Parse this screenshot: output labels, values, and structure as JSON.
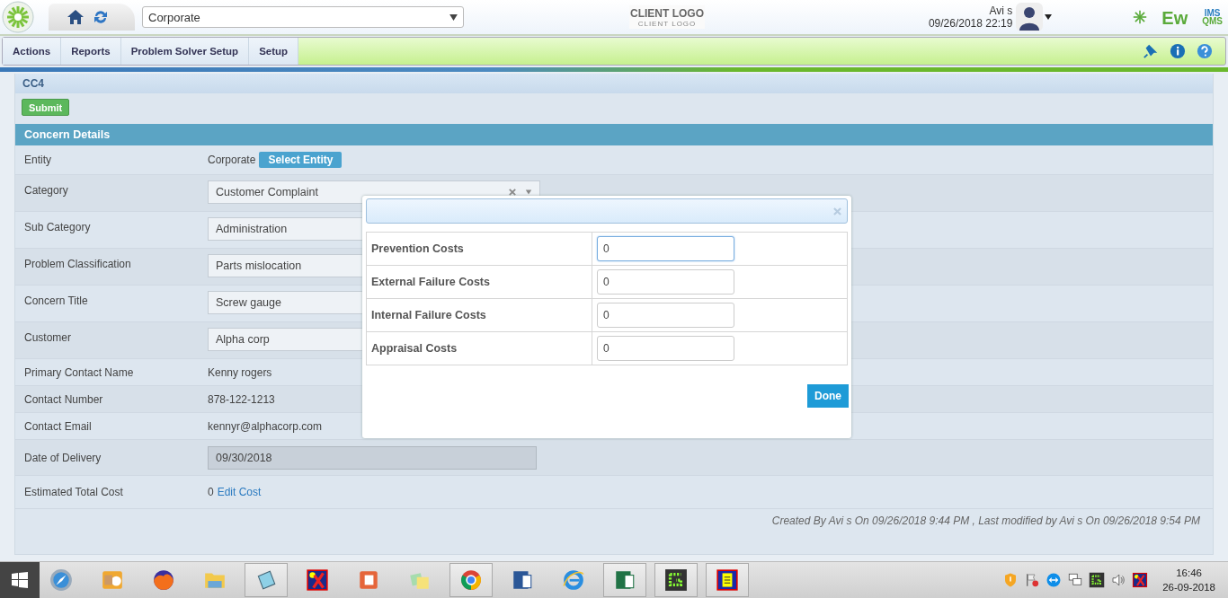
{
  "header": {
    "entity_select": {
      "value": "Corporate"
    },
    "client_logo": {
      "title": "CLIENT LOGO",
      "subtitle": "CLIENT LOGO"
    },
    "user": {
      "name": "Avi s",
      "datetime": "09/26/2018 22:19"
    },
    "brand": {
      "main": "Ew",
      "top": "IMS",
      "bottom": "QMS"
    }
  },
  "menu": [
    {
      "label": "Actions"
    },
    {
      "label": "Reports"
    },
    {
      "label": "Problem Solver Setup"
    },
    {
      "label": "Setup"
    }
  ],
  "page": {
    "title": "CC4",
    "submit": "Submit",
    "section": "Concern Details",
    "rows": [
      {
        "label": "Entity",
        "kind": "entity",
        "value": "Corporate",
        "button": "Select Entity"
      },
      {
        "label": "Category",
        "kind": "select",
        "value": "Customer Complaint"
      },
      {
        "label": "Sub Category",
        "kind": "input",
        "value": "Administration"
      },
      {
        "label": "Problem Classification",
        "kind": "input",
        "value": "Parts mislocation"
      },
      {
        "label": "Concern Title",
        "kind": "input",
        "value": "Screw gauge"
      },
      {
        "label": "Customer",
        "kind": "input",
        "value": "Alpha corp"
      },
      {
        "label": "Primary Contact Name",
        "kind": "text",
        "value": "Kenny rogers"
      },
      {
        "label": "Contact Number",
        "kind": "text",
        "value": "878-122-1213"
      },
      {
        "label": "Contact Email",
        "kind": "text",
        "value": "kennyr@alphacorp.com"
      },
      {
        "label": "Date of Delivery",
        "kind": "readonly",
        "value": "09/30/2018"
      },
      {
        "label": "Estimated Total Cost",
        "kind": "cost",
        "value": "0",
        "link": "Edit Cost"
      }
    ],
    "footer": "Created By Avi s On 09/26/2018 9:44 PM , Last modified by Avi s On 09/26/2018 9:54 PM"
  },
  "dialog": {
    "rows": [
      {
        "label": "Prevention Costs",
        "value": "0",
        "focused": true
      },
      {
        "label": "External Failure Costs",
        "value": "0",
        "focused": false
      },
      {
        "label": "Internal Failure Costs",
        "value": "0",
        "focused": false
      },
      {
        "label": "Appraisal Costs",
        "value": "0",
        "focused": false
      }
    ],
    "done": "Done"
  },
  "taskbar": {
    "apps": [
      {
        "kind": "compass",
        "open": false
      },
      {
        "kind": "mail",
        "open": false
      },
      {
        "kind": "fox",
        "open": false
      },
      {
        "kind": "folder",
        "open": false
      },
      {
        "kind": "notepad",
        "open": true
      },
      {
        "kind": "redx",
        "open": false
      },
      {
        "kind": "slides",
        "open": false
      },
      {
        "kind": "sticky",
        "open": false
      },
      {
        "kind": "chrome",
        "open": true
      },
      {
        "kind": "word",
        "open": false
      },
      {
        "kind": "ie",
        "open": false
      },
      {
        "kind": "excel",
        "open": true
      },
      {
        "kind": "dots",
        "open": true
      },
      {
        "kind": "yellow",
        "open": true
      }
    ],
    "tray": [
      {
        "kind": "shield"
      },
      {
        "kind": "flag"
      },
      {
        "kind": "remote"
      },
      {
        "kind": "network"
      },
      {
        "kind": "dots"
      },
      {
        "kind": "speaker"
      },
      {
        "kind": "redx"
      }
    ],
    "time": "16:46",
    "date": "26-09-2018"
  }
}
